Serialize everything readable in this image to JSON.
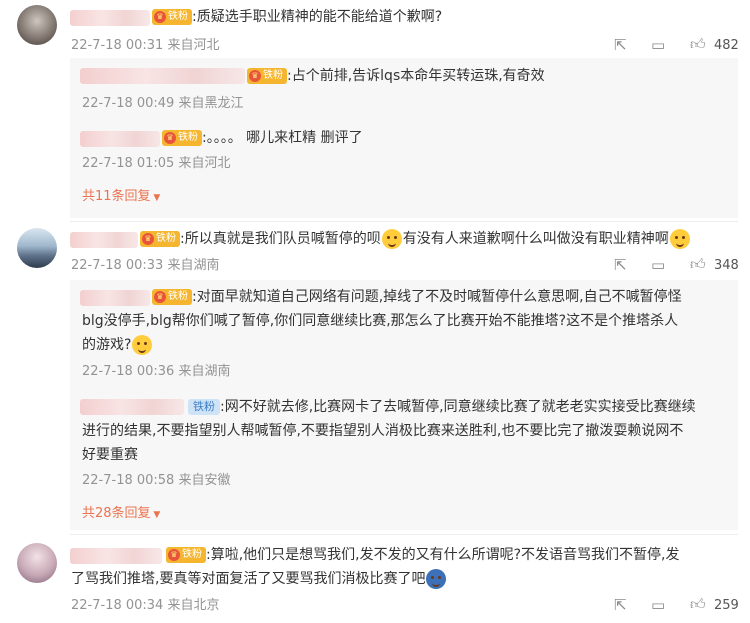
{
  "comments": [
    {
      "badge": "铁粉",
      "text": ":质疑选手职业精神的能不能给道个歉啊?",
      "meta": "22-7-18 00:31 来自河北",
      "likes": "482",
      "replies": [
        {
          "badge": "铁粉",
          "text": ":占个前排,告诉lqs本命年买转运珠,有奇效",
          "meta": "22-7-18 00:49 来自黑龙江"
        },
        {
          "badge": "铁粉",
          "text": ":。。。。 哪儿来杠精 删评了",
          "meta": "22-7-18 01:05 来自河北"
        }
      ],
      "more": "共11条回复"
    },
    {
      "badge": "铁粉",
      "text_a": ":所以真就是我们队员喊暂停的呗",
      "text_b": "有没有人来道歉啊什么叫做没有职业精神啊",
      "meta": "22-7-18 00:33 来自湖南",
      "likes": "348",
      "replies": [
        {
          "badge": "铁粉",
          "line1": ":对面早就知道自己网络有问题,掉线了不及时喊暂停什么意思啊,自己不喊暂停怪",
          "line2": "blg没停手,blg帮你们喊了暂停,你们同意继续比赛,那怎么了比赛开始不能推塔?这不是个推塔杀人",
          "line3": "的游戏?",
          "meta": "22-7-18 00:36 来自湖南"
        },
        {
          "badge": "铁粉",
          "line1": ":网不好就去修,比赛网卡了去喊暂停,同意继续比赛了就老老实实接受比赛继续",
          "line2": "进行的结果,不要指望别人帮喊暂停,不要指望别人消极比赛来送胜利,也不要比完了撤泼耍赖说网不",
          "line3": "好要重赛",
          "meta": "22-7-18 00:58 来自安徽"
        }
      ],
      "more": "共28条回复"
    },
    {
      "badge": "铁粉",
      "line1": ":算啦,他们只是想骂我们,发不发的又有什么所谓呢?不发语音骂我们不暂停,发",
      "line2": "了骂我们推塔,要真等对面复活了又要骂我们消极比赛了吧",
      "meta": "22-7-18 00:34 来自北京",
      "likes": "259"
    }
  ],
  "icons": [
    "share-icon",
    "comment-icon",
    "like-icon",
    "dropdown-arrow-icon"
  ],
  "colors": {
    "more_link": "#eb7350",
    "badge_gold": "#f5b52e",
    "badge_blue": "#cfe3f7",
    "meta": "#939393"
  }
}
